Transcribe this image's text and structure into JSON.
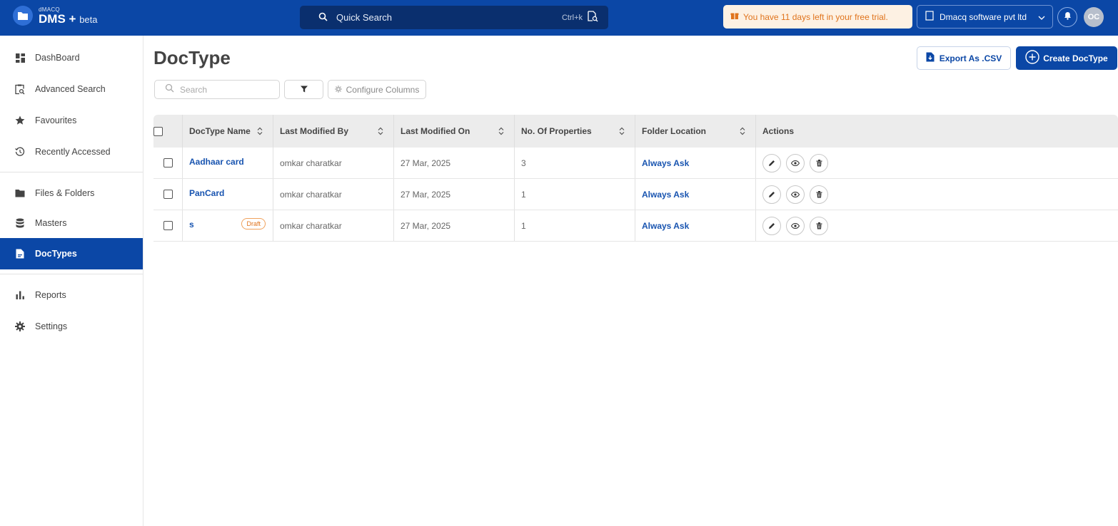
{
  "brand": {
    "small": "dMACQ",
    "name": "DMS",
    "plus": "+",
    "suffix": "beta"
  },
  "header": {
    "quick_search_label": "Quick Search",
    "quick_search_shortcut": "Ctrl+k",
    "trial_text": "You have 11 days left in your free trial.",
    "org_name": "Dmacq software pvt ltd",
    "avatar_initials": "OC"
  },
  "sidebar": {
    "items": [
      {
        "label": "DashBoard",
        "icon": "dashboard-icon"
      },
      {
        "label": "Advanced Search",
        "icon": "advanced-search-icon"
      },
      {
        "label": "Favourites",
        "icon": "star-icon"
      },
      {
        "label": "Recently Accessed",
        "icon": "history-icon"
      },
      {
        "label": "Files & Folders",
        "icon": "folder-icon"
      },
      {
        "label": "Masters",
        "icon": "database-icon"
      },
      {
        "label": "DocTypes",
        "icon": "doctype-icon",
        "active": true
      },
      {
        "label": "Reports",
        "icon": "reports-icon"
      },
      {
        "label": "Settings",
        "icon": "gear-icon"
      }
    ]
  },
  "main": {
    "title": "DocType",
    "export_label": "Export As .CSV",
    "create_label": "Create DocType",
    "search_placeholder": "Search",
    "configure_label": "Configure Columns"
  },
  "table": {
    "columns": [
      "DocType Name",
      "Last Modified By",
      "Last Modified On",
      "No. Of Properties",
      "Folder Location",
      "Actions"
    ],
    "rows": [
      {
        "name": "Aadhaar card",
        "badge": "",
        "modified_by": "omkar charatkar",
        "modified_on": "27 Mar, 2025",
        "properties": "3",
        "folder": "Always Ask"
      },
      {
        "name": "PanCard",
        "badge": "",
        "modified_by": "omkar charatkar",
        "modified_on": "27 Mar, 2025",
        "properties": "1",
        "folder": "Always Ask"
      },
      {
        "name": "s",
        "badge": "Draft",
        "modified_by": "omkar charatkar",
        "modified_on": "27 Mar, 2025",
        "properties": "1",
        "folder": "Always Ask"
      }
    ]
  },
  "colors": {
    "primary": "#0b47a6",
    "quick_search_bg": "#0a2f6e",
    "trial_bg": "#fdf1e3",
    "trial_text": "#e0741d",
    "link": "#1854b0"
  }
}
